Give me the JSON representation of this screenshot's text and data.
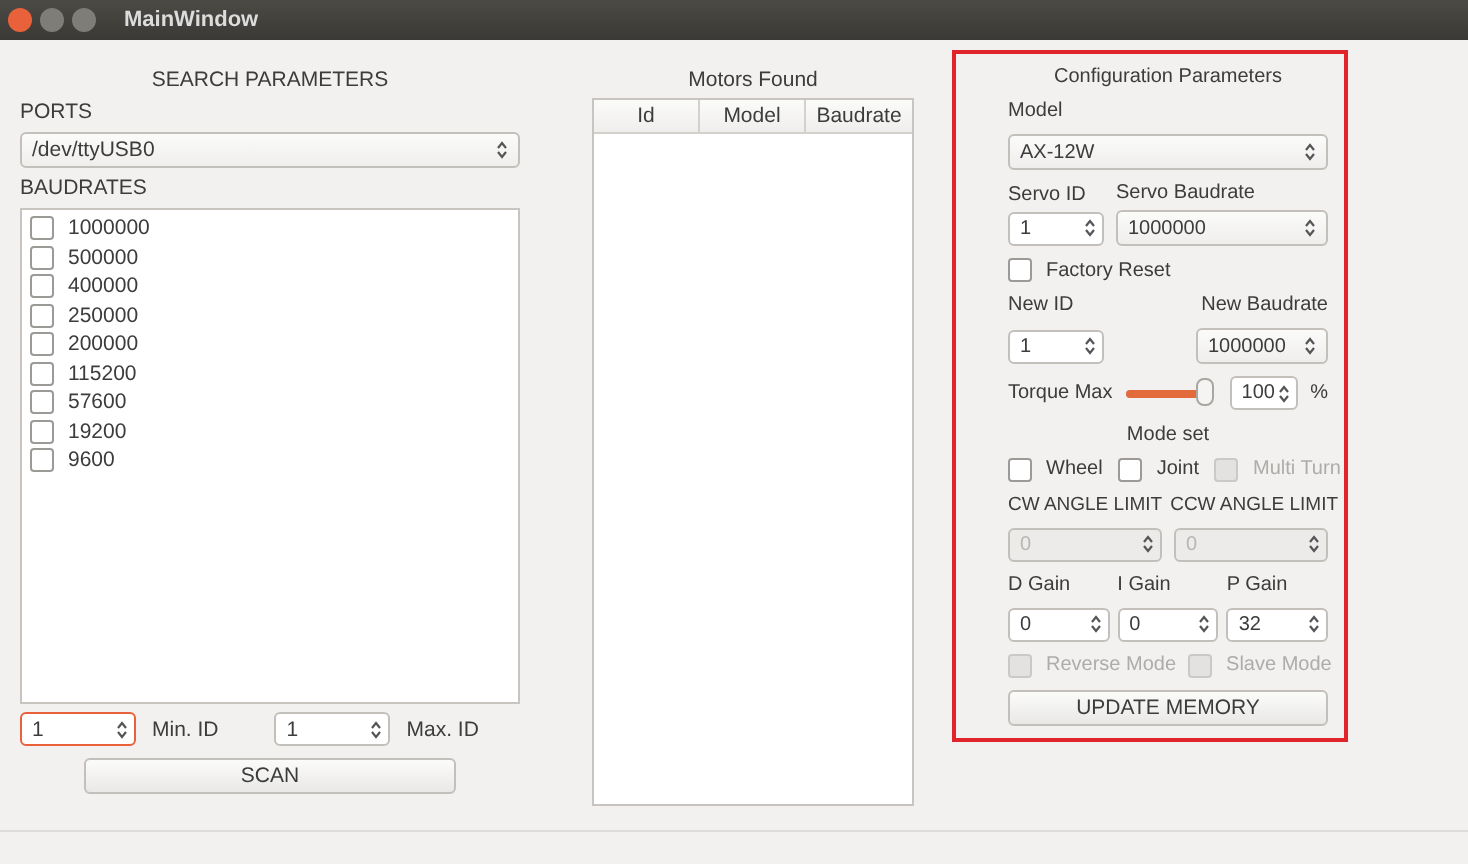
{
  "window": {
    "title": "MainWindow"
  },
  "search": {
    "title": "SEARCH PARAMETERS",
    "ports_label": "PORTS",
    "port": "/dev/ttyUSB0",
    "baudrates_label": "BAUDRATES",
    "baudrates": [
      {
        "label": "1000000",
        "checked": false
      },
      {
        "label": "500000",
        "checked": false
      },
      {
        "label": "400000",
        "checked": false
      },
      {
        "label": "250000",
        "checked": false
      },
      {
        "label": "200000",
        "checked": false
      },
      {
        "label": "115200",
        "checked": false
      },
      {
        "label": "57600",
        "checked": false
      },
      {
        "label": "19200",
        "checked": false
      },
      {
        "label": "9600",
        "checked": false
      }
    ],
    "min_id": {
      "value": "1",
      "label": "Min. ID",
      "focused": true
    },
    "max_id": {
      "value": "1",
      "label": "Max. ID",
      "focused": false
    },
    "scan_button": "SCAN"
  },
  "motors": {
    "title": "Motors Found",
    "columns": [
      "Id",
      "Model",
      "Baudrate"
    ]
  },
  "config": {
    "title": "Configuration Parameters",
    "model_label": "Model",
    "model": "AX-12W",
    "servo_id_label": "Servo ID",
    "servo_id": "1",
    "servo_baudrate_label": "Servo Baudrate",
    "servo_baudrate": "1000000",
    "factory_reset": {
      "label": "Factory Reset",
      "checked": false
    },
    "new_id_label": "New ID",
    "new_id": "1",
    "new_baudrate_label": "New Baudrate",
    "new_baudrate": "1000000",
    "torque": {
      "label": "Torque Max",
      "level": 1,
      "value": "100",
      "unit": "%"
    },
    "mode_label": "Mode set",
    "modes": [
      {
        "label": "Wheel",
        "checked": false,
        "disabled": false
      },
      {
        "label": "Joint",
        "checked": false,
        "disabled": false
      },
      {
        "label": "Multi Turn",
        "checked": false,
        "disabled": true
      }
    ],
    "cw_label": "CW ANGLE LIMIT",
    "ccw_label": "CCW ANGLE LIMIT",
    "cw": {
      "value": "0",
      "disabled": true
    },
    "ccw": {
      "value": "0",
      "disabled": true
    },
    "gains": [
      {
        "label": "D Gain",
        "value": "0"
      },
      {
        "label": "I Gain",
        "value": "0"
      },
      {
        "label": "P Gain",
        "value": "32"
      }
    ],
    "options": [
      {
        "label": "Reverse Mode",
        "checked": false,
        "disabled": true
      },
      {
        "label": "Slave Mode",
        "checked": false,
        "disabled": true
      }
    ],
    "update_button": "UPDATE MEMORY"
  }
}
